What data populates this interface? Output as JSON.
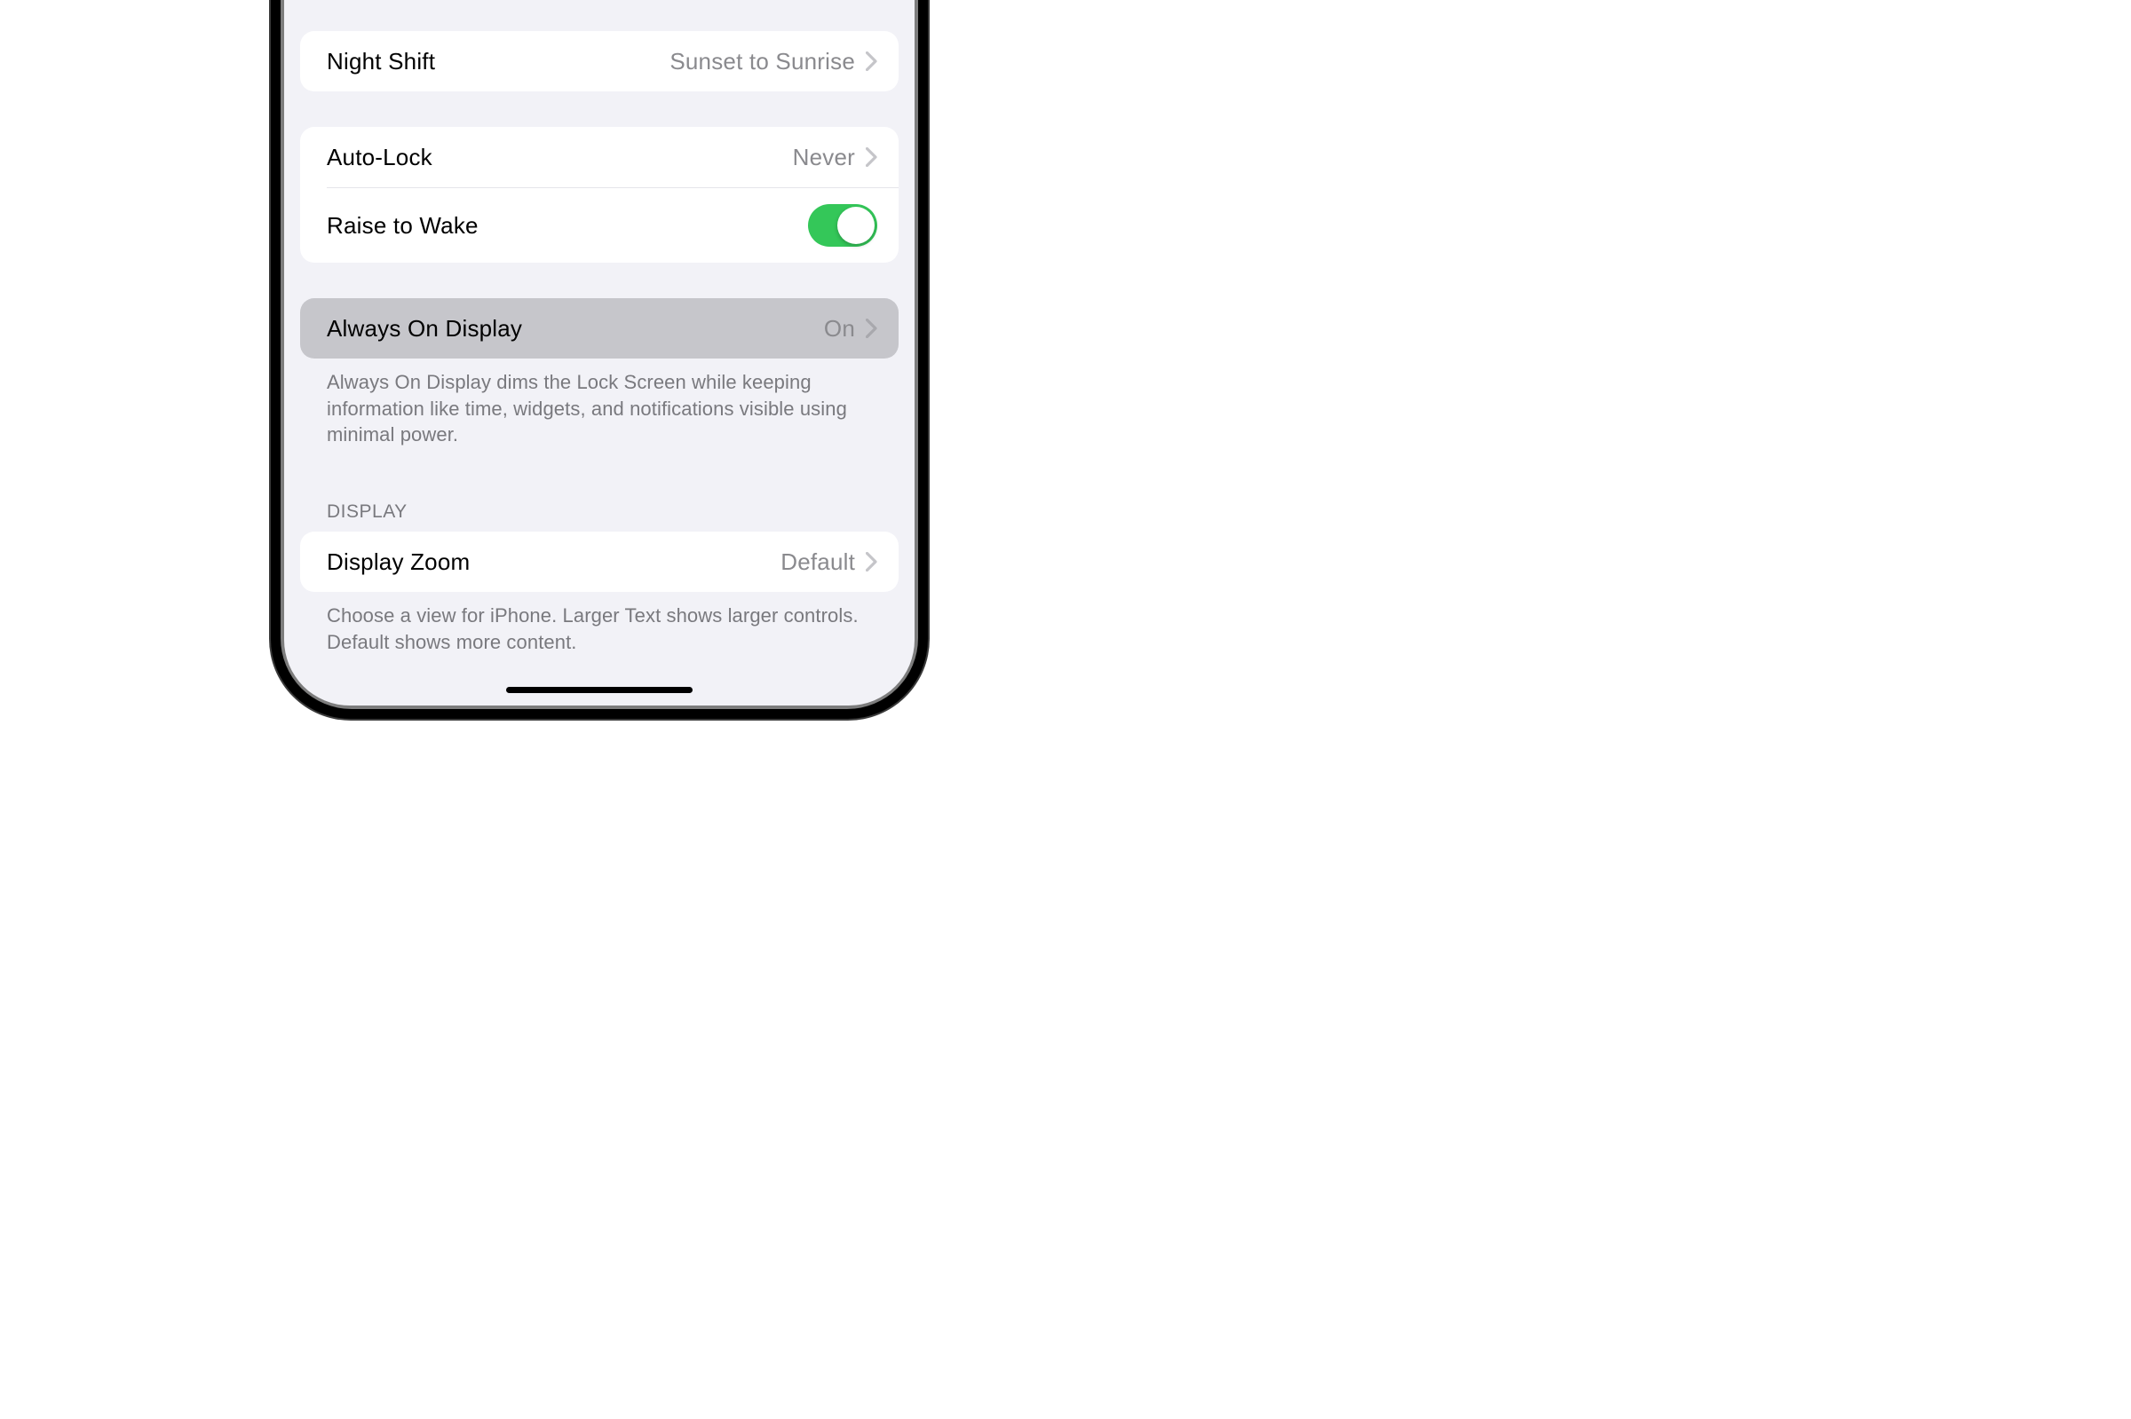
{
  "sections": {
    "nightShift": {
      "label": "Night Shift",
      "value": "Sunset to Sunrise"
    },
    "lock": {
      "autoLock": {
        "label": "Auto-Lock",
        "value": "Never"
      },
      "raiseToWake": {
        "label": "Raise to Wake",
        "on": true
      }
    },
    "aod": {
      "label": "Always On Display",
      "value": "On",
      "footer": "Always On Display dims the Lock Screen while keeping information like time, widgets, and notifications visible using minimal power."
    },
    "display": {
      "header": "DISPLAY",
      "zoom": {
        "label": "Display Zoom",
        "value": "Default"
      },
      "footer": "Choose a view for iPhone. Larger Text shows larger controls. Default shows more content."
    }
  },
  "colors": {
    "toggleOn": "#34c759",
    "background": "#f2f2f7",
    "highlighted": "#c6c6cb"
  }
}
